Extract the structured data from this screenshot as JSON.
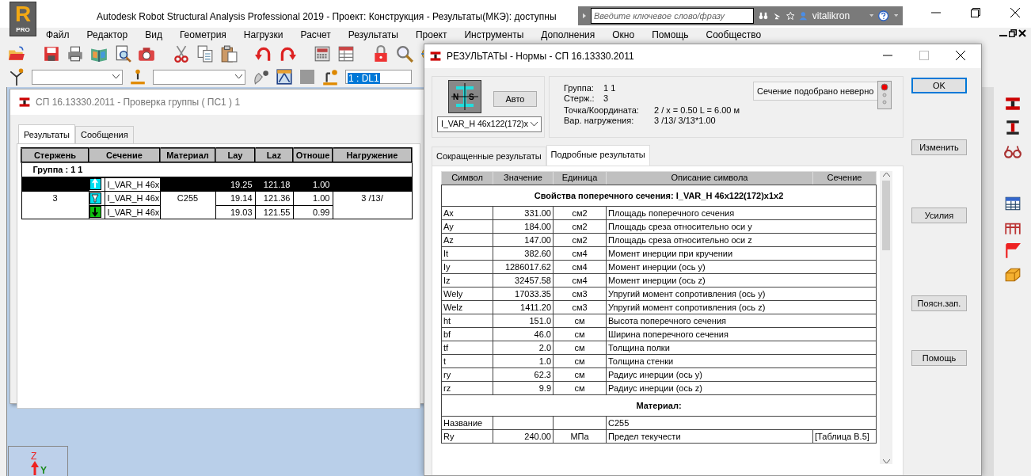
{
  "app": {
    "logo_letter": "R",
    "logo_badge": "PRO",
    "title": "Autodesk Robot Structural Analysis Professional 2019 - Проект: Конструкция - Результаты(МКЭ): доступны",
    "search_placeholder": "Введите ключевое слово/фразу",
    "user": "vitalikron",
    "menu": [
      "Файл",
      "Редактор",
      "Вид",
      "Геометрия",
      "Нагрузки",
      "Расчет",
      "Результаты",
      "Проект",
      "Инструменты",
      "Дополнения",
      "Окно",
      "Помощь",
      "Сообщество"
    ],
    "load_case": "1 : DL1"
  },
  "group_dialog": {
    "title": "СП 16.13330.2011 - Проверка группы ( ПС1 ) 1",
    "tabs": [
      {
        "label": "Результаты",
        "selected": true
      },
      {
        "label": "Сообщения",
        "selected": false
      }
    ],
    "columns": [
      "Стержень",
      "Сечение",
      "Материал",
      "Lay",
      "Laz",
      "Отноше",
      "Нагружение"
    ],
    "group": "Группа : 1  1",
    "bar": "3",
    "material": "C255",
    "load_case": "3  /13/",
    "rows": [
      {
        "kind": "max",
        "section": "I_VAR_H 46x",
        "lay": "19.25",
        "laz": "121.18",
        "ratio": "1.00",
        "selected": true
      },
      {
        "kind": "mid",
        "section": "I_VAR_H 46x",
        "lay": "19.14",
        "laz": "121.36",
        "ratio": "1.00",
        "selected": false
      },
      {
        "kind": "min",
        "section": "I_VAR_H 46x",
        "lay": "19.03",
        "laz": "121.55",
        "ratio": "0.99",
        "selected": false
      }
    ]
  },
  "results": {
    "title": "РЕЗУЛЬТАТЫ - Нормы - СП 16.13330.2011",
    "section_labels": [
      "N",
      "S"
    ],
    "auto_button": "Авто",
    "section_select": "I_VAR_H 46x122(172)x",
    "summary": [
      {
        "label": "Группа:",
        "value": "1  1"
      },
      {
        "label": "Стерж.:",
        "value": "3"
      }
    ],
    "details": [
      {
        "label": "Точка/Координата:",
        "value": "2 / x = 0.50 L = 6.00 м"
      },
      {
        "label": "Вар. нагружения:",
        "value": "3  /13/  3/13*1.00"
      }
    ],
    "status_text": "Сечение подобрано неверно",
    "passed": false,
    "buttons": [
      "OK",
      "Изменить",
      "Усилия",
      "Поясн.зап.",
      "Помощь"
    ],
    "tabs": [
      {
        "label": "Сокращенные результаты",
        "selected": false
      },
      {
        "label": "Подробные результаты",
        "selected": true
      }
    ],
    "columns": [
      "Символ",
      "Значение",
      "Единица",
      "Описание символа",
      "Сечение"
    ],
    "rows": [
      {
        "kind": "heading",
        "text": "Свойства поперечного сечения: I_VAR_H 46x122(172)x1x2"
      },
      {
        "kind": "data",
        "symbol": "Ax",
        "value": "331.00",
        "unit": "см2",
        "description": "Площадь поперечного сечения"
      },
      {
        "kind": "data",
        "symbol": "Ay",
        "value": "184.00",
        "unit": "см2",
        "description": "Площадь среза относительно оси y"
      },
      {
        "kind": "data",
        "symbol": "Az",
        "value": "147.00",
        "unit": "см2",
        "description": "Площадь среза относительно оси z"
      },
      {
        "kind": "data",
        "symbol": "It",
        "value": "382.60",
        "unit": "см4",
        "description": "Момент инерции при кручении"
      },
      {
        "kind": "data",
        "symbol": "Iy",
        "value": "1286017.62",
        "unit": "см4",
        "description": "Момент инерции (ось y)"
      },
      {
        "kind": "data",
        "symbol": "Iz",
        "value": "32457.58",
        "unit": "см4",
        "description": "Момент инерции (ось z)"
      },
      {
        "kind": "data",
        "symbol": "Wely",
        "value": "17033.35",
        "unit": "см3",
        "description": "Упругий момент сопротивления (ось y)"
      },
      {
        "kind": "data",
        "symbol": "Welz",
        "value": "1411.20",
        "unit": "см3",
        "description": "Упругий момент сопротивления (ось z)"
      },
      {
        "kind": "data",
        "symbol": "ht",
        "value": "151.0",
        "unit": "см",
        "description": "Высота поперечного сечения"
      },
      {
        "kind": "data",
        "symbol": "bf",
        "value": "46.0",
        "unit": "см",
        "description": "Ширина поперечного сечения"
      },
      {
        "kind": "data",
        "symbol": "tf",
        "value": "2.0",
        "unit": "см",
        "description": "Толщина полки"
      },
      {
        "kind": "data",
        "symbol": "t",
        "value": "1.0",
        "unit": "см",
        "description": "Толщина стенки"
      },
      {
        "kind": "data",
        "symbol": "ry",
        "value": "62.3",
        "unit": "см",
        "description": "Радиус инерции (ось y)"
      },
      {
        "kind": "data",
        "symbol": "rz",
        "value": "9.9",
        "unit": "см",
        "description": "Радиус инерции (ось z)"
      },
      {
        "kind": "heading",
        "text": "Материал:"
      },
      {
        "kind": "data",
        "symbol": "Название",
        "value": "",
        "unit": "",
        "description": "C255"
      },
      {
        "kind": "data",
        "symbol": "Ry",
        "value": "240.00",
        "unit": "МПа",
        "description": "Предел текучести",
        "section": "[Таблица В.5]"
      }
    ]
  },
  "axis": {
    "z": "Z",
    "y": "Y"
  }
}
